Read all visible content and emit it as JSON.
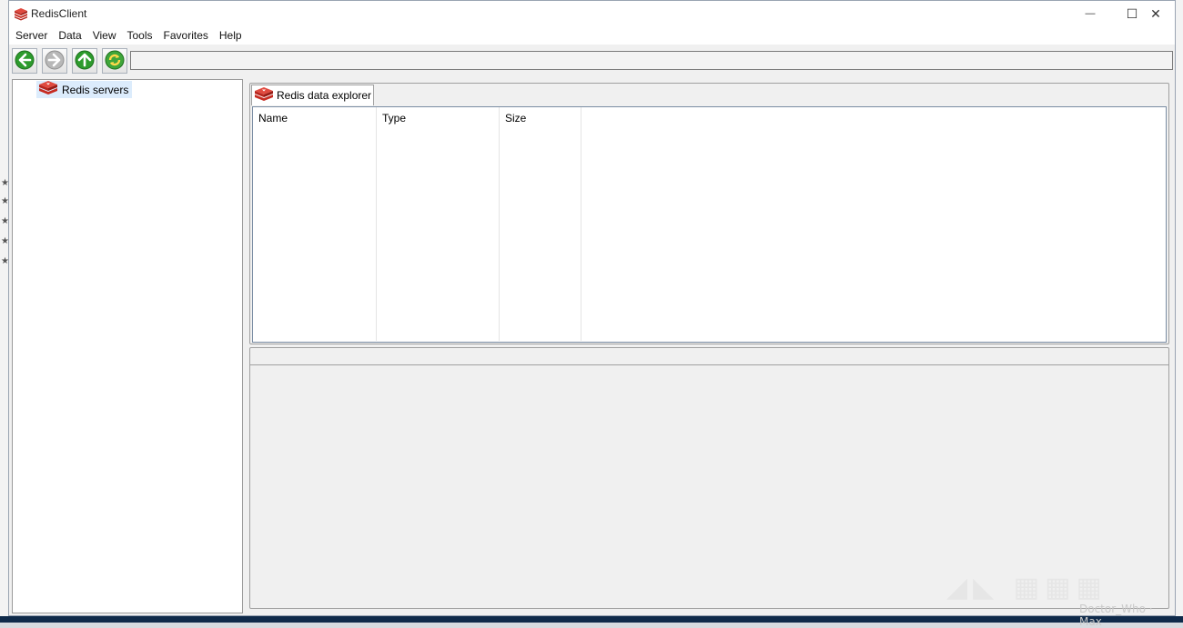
{
  "window": {
    "title": "RedisClient",
    "controls": {
      "minimize": "—",
      "maximize": "☐",
      "close": "✕"
    }
  },
  "menu": [
    "Server",
    "Data",
    "View",
    "Tools",
    "Favorites",
    "Help"
  ],
  "toolbar": {
    "buttons": [
      {
        "name": "back-button",
        "icon": "arrow-left-icon"
      },
      {
        "name": "forward-button",
        "icon": "arrow-right-icon"
      },
      {
        "name": "up-button",
        "icon": "arrow-up-icon"
      },
      {
        "name": "refresh-button",
        "icon": "refresh-icon"
      }
    ],
    "address_value": ""
  },
  "tree": {
    "root_label": "Redis servers"
  },
  "explorer": {
    "tab_label": "Redis data explorer",
    "columns": [
      "Name",
      "Type",
      "Size"
    ]
  },
  "watermark": "Doctor_Who · Max",
  "colors": {
    "redis_red": "#d13228",
    "toolbar_green": "#2d9b2d",
    "selection": "#dcecfc"
  }
}
